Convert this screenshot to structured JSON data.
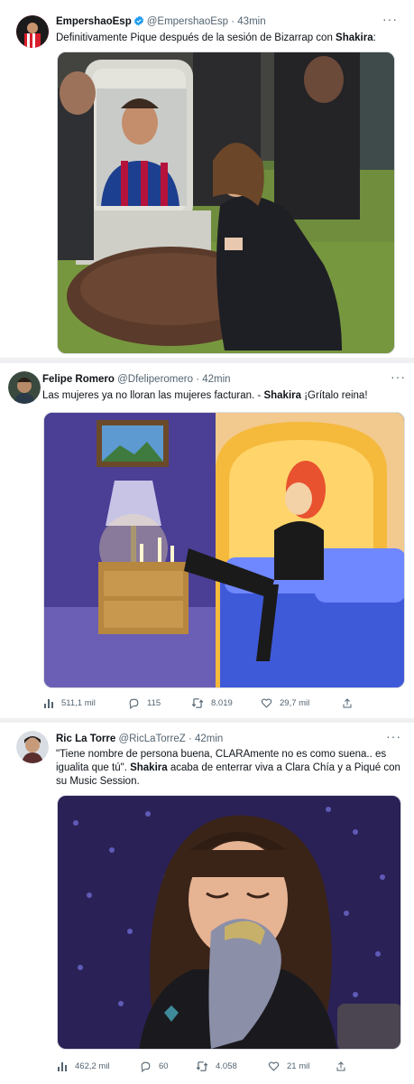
{
  "tweets": [
    {
      "name": "EmpershaoEsp",
      "handle": "@EmpershaoEsp",
      "time": "43min",
      "text_parts": [
        "Definitivamente Pique después de la sesión de Bizarrap con ",
        "Shakira",
        ":"
      ],
      "image_alt": "meme-grave-pique-shakira"
    },
    {
      "name": "Felipe Romero",
      "handle": "@Dfeliperomero",
      "time": "42min",
      "text_parts": [
        "Las mujeres ya no lloran las mujeres facturan. - ",
        "Shakira",
        " ¡Grítalo reina!"
      ],
      "stats": {
        "views": "511,1 mil",
        "replies": "115",
        "retweets": "8.019",
        "likes": "29,7 mil"
      }
    },
    {
      "name": "Ric La Torre",
      "handle": "@RicLaTorreZ",
      "time": "42min",
      "text_parts": [
        "\"Tiene nombre de persona buena, CLARAmente no es como suena.. es igualita que tú\". ",
        "Shakira",
        " acaba de enterrar viva a Clara Chía y a Piqué con su Music Session."
      ],
      "stats": {
        "views": "462,2 mil",
        "replies": "60",
        "retweets": "4.058",
        "likes": "21 mil"
      }
    }
  ],
  "dots": "···",
  "colors": {
    "verified": "#1d9bf0",
    "text": "#0f1419",
    "muted": "#536471"
  }
}
